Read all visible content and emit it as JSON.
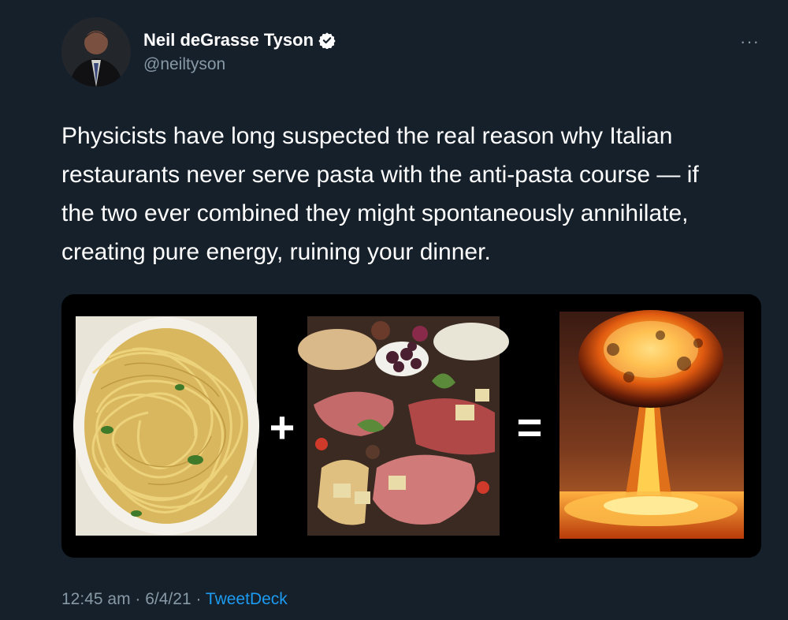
{
  "author": {
    "name": "Neil deGrasse Tyson",
    "handle": "@neiltyson",
    "verified_icon": "verified-badge-icon"
  },
  "more_label": "···",
  "tweet": {
    "lines": [
      "Physicists have long suspected the real reason why Italian",
      "restaurants never serve pasta with the anti-pasta course —  if",
      "the two ever combined they might spontaneously annihilate,",
      "creating pure energy, ruining your dinner."
    ]
  },
  "media": {
    "plus": "+",
    "equals": "="
  },
  "footer": {
    "time": "12:45 am",
    "sep1": " · ",
    "date": "6/4/21",
    "sep2": " · ",
    "source": "TweetDeck"
  },
  "colors": {
    "background": "#15202b",
    "secondary_text": "#8899a6",
    "link": "#1d9bf0"
  }
}
